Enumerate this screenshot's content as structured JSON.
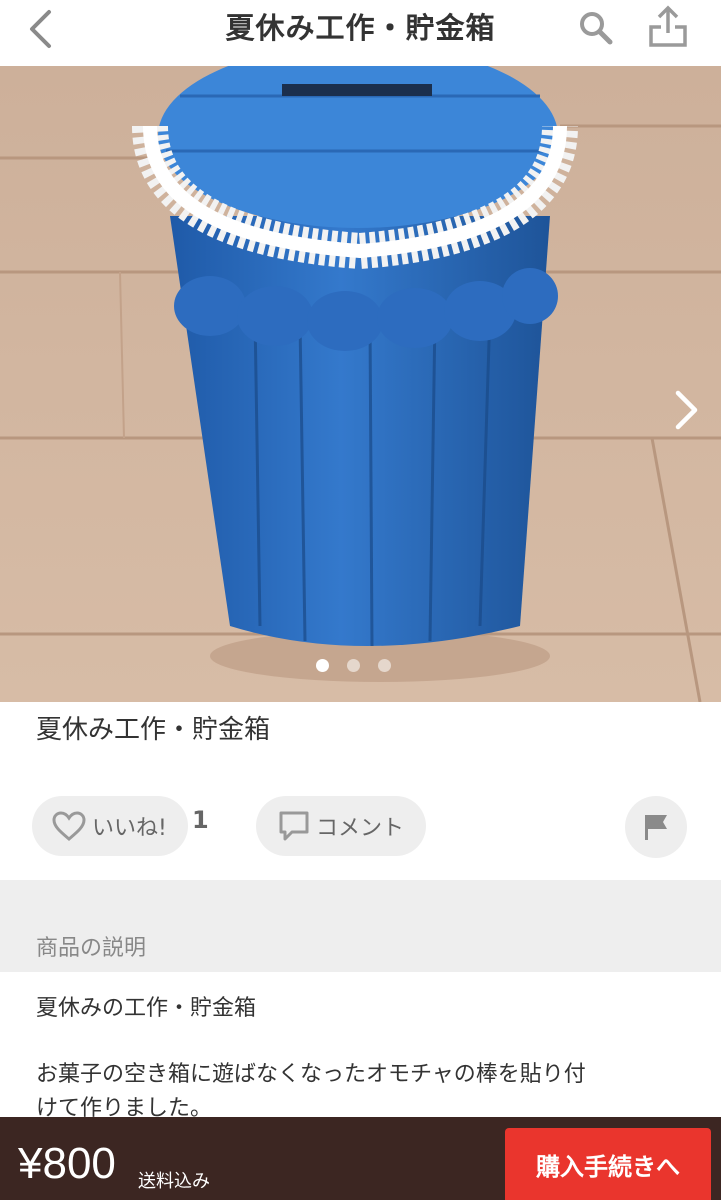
{
  "header": {
    "title": "夏休み工作・貯金箱",
    "back_icon": "chevron-left-icon",
    "search_icon": "search-icon",
    "share_icon": "share-icon"
  },
  "photo": {
    "alt": "blue popsicle-stick piggy bank with lace trim",
    "slide_count": 3,
    "active_slide": 1,
    "next_icon": "chevron-right-icon"
  },
  "item": {
    "title": "夏休み工作・貯金箱"
  },
  "actions": {
    "like_label": "いいね!",
    "like_count": "1",
    "comment_label": "コメント",
    "report_icon": "flag-icon"
  },
  "description": {
    "section_label": "商品の説明",
    "lines": [
      "夏休みの工作・貯金箱",
      "お菓子の空き箱に遊ばなくなったオモチャの棒を貼り付",
      "けて作りました。"
    ]
  },
  "purchase": {
    "price": "¥800",
    "shipping": "送料込み",
    "buy_label": "購入手続きへ"
  },
  "colors": {
    "accent": "#ea352d",
    "buy_bar": "#3c2622",
    "section_bg": "#eeeeee",
    "box_blue": "#2f6fbf"
  }
}
